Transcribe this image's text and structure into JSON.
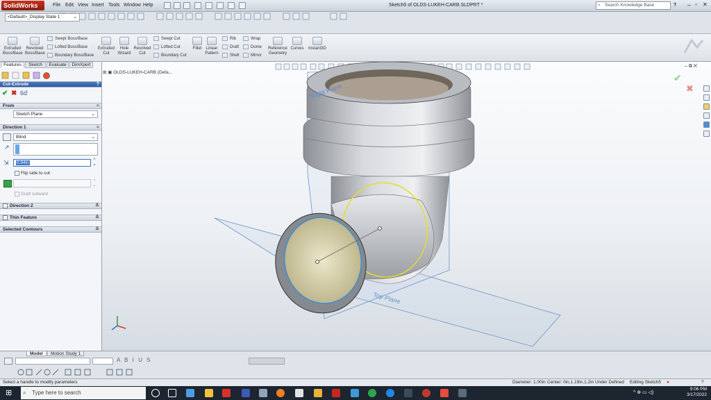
{
  "app": {
    "logo": "SolidWorks",
    "document_title": "Sketch5 of OLDS-LUKEH-CARB.SLDPRT *"
  },
  "menu": [
    "File",
    "Edit",
    "View",
    "Insert",
    "Tools",
    "Window",
    "Help"
  ],
  "search": {
    "placeholder": "Search Knowledge Base"
  },
  "help_label": "?",
  "config": {
    "display_state": "<Default>_Display State 1"
  },
  "ribbon": {
    "extruded_boss": "Extruded Boss/Base",
    "revolved_boss": "Revolved Boss/Base",
    "swept_boss": "Swept Boss/Base",
    "lofted_boss": "Lofted Boss/Base",
    "boundary_boss": "Boundary Boss/Base",
    "extruded_cut": "Extruded Cut",
    "hole_wizard": "Hole Wizard",
    "revolved_cut": "Revolved Cut",
    "swept_cut": "Swept Cut",
    "lofted_cut": "Lofted Cut",
    "boundary_cut": "Boundary Cut",
    "fillet": "Fillet",
    "linear_pattern": "Linear Pattern",
    "rib": "Rib",
    "draft": "Draft",
    "shell": "Shell",
    "wrap": "Wrap",
    "dome": "Dome",
    "mirror": "Mirror",
    "reference_geometry": "Reference Geometry",
    "curves": "Curves",
    "instant3d": "Instant3D"
  },
  "tabs": [
    "Features",
    "Sketch",
    "Evaluate",
    "DimXpert"
  ],
  "property_manager": {
    "title": "Cut-Extrude",
    "from_section": "From",
    "from_value": "Sketch Plane",
    "direction1_section": "Direction 1",
    "end_condition": "Blind",
    "depth": "0.94in",
    "flip_side": "Flip side to cut",
    "draft_outward": "Draft outward",
    "direction2": "Direction 2",
    "thin_feature": "Thin Feature",
    "selected_contours": "Selected Contours"
  },
  "tree": {
    "part_name": "OLDS-LUKEH-CARB (Defa..."
  },
  "viewport": {
    "right_plane": "Right Plane",
    "top_plane": "Top Plane"
  },
  "bottom_tabs": [
    "Model",
    "Motion Study 1"
  ],
  "status": {
    "message": "Select a handle to modify parameters",
    "diameter": "Diameter: 1.00in",
    "center": "Center: 0in,1.19in,1.2in",
    "definition": "Under Defined",
    "editing": "Editing Sketch5"
  },
  "taskbar": {
    "search_placeholder": "Type here to search",
    "time": "9:06 PM",
    "date": "3/17/2022"
  },
  "colors": {
    "accent": "#1f4f9a",
    "selection_yellow": "#e6de2a",
    "edge_blue": "#3a8fd6"
  }
}
